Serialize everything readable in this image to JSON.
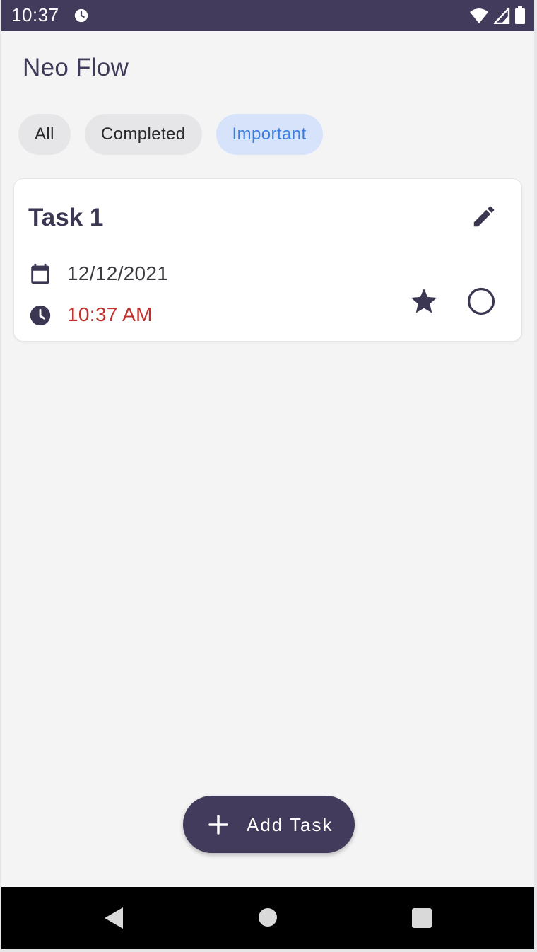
{
  "status_bar": {
    "time": "10:37",
    "icons": [
      "alarm-icon",
      "wifi-icon",
      "cellular-signal-icon",
      "battery-icon"
    ]
  },
  "app": {
    "title": "Neo Flow"
  },
  "filters": {
    "chips": [
      {
        "label": "All",
        "selected": false
      },
      {
        "label": "Completed",
        "selected": false
      },
      {
        "label": "Important",
        "selected": true
      }
    ]
  },
  "tasks": [
    {
      "title": "Task 1",
      "date": "12/12/2021",
      "time": "10:37 AM",
      "important": true,
      "completed": false,
      "icons": [
        "edit-icon",
        "calendar-icon",
        "clock-icon",
        "star-icon",
        "circle-outline-icon"
      ]
    }
  ],
  "fab": {
    "label": "Add Task",
    "icon": "plus-icon"
  },
  "colors": {
    "primary": "#433b5b",
    "background": "#f4f4f5",
    "chip_selected_bg": "#d6e3fb",
    "chip_selected_text": "#3c7ee0",
    "time_text": "#c0302e"
  },
  "navigation_bar": {
    "buttons": [
      "back-icon",
      "home-icon",
      "recents-icon"
    ]
  }
}
